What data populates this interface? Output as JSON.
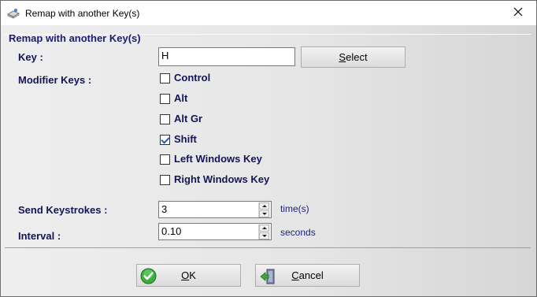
{
  "window": {
    "title": "Remap with another Key(s)"
  },
  "group": {
    "title": "Remap with another Key(s)"
  },
  "key": {
    "label": "Key :",
    "value": "H",
    "select_button": {
      "mnemonic": "S",
      "rest": "elect"
    }
  },
  "modifiers": {
    "label": "Modifier Keys :",
    "items": [
      {
        "label": "Control",
        "checked": false
      },
      {
        "label": "Alt",
        "checked": false
      },
      {
        "label": "Alt Gr",
        "checked": false
      },
      {
        "label": "Shift",
        "checked": true
      },
      {
        "label": "Left Windows Key",
        "checked": false
      },
      {
        "label": "Right Windows Key",
        "checked": false
      }
    ]
  },
  "send_keystrokes": {
    "label": "Send Keystrokes :",
    "value": "3",
    "unit": "time(s)"
  },
  "interval": {
    "label": "Interval  :",
    "value": "0.10",
    "unit": "seconds"
  },
  "buttons": {
    "ok": {
      "mnemonic": "O",
      "rest": "K",
      "icon": "check-circle-icon"
    },
    "cancel": {
      "mnemonic": "C",
      "rest": "ancel",
      "icon": "exit-door-icon"
    }
  },
  "colors": {
    "label_text": "#141457",
    "check_green": "#2e9e2e"
  }
}
